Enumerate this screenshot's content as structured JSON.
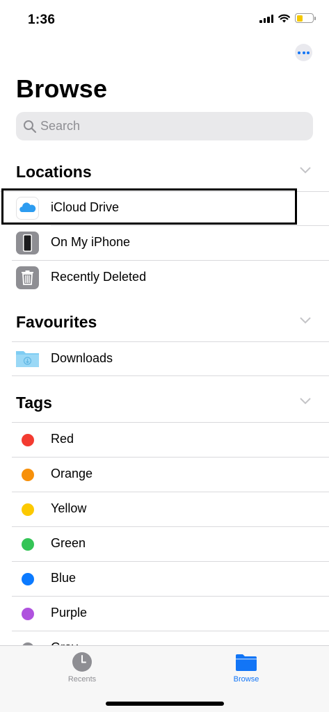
{
  "status_bar": {
    "time": "1:36",
    "battery_color": "#f4c800"
  },
  "header": {
    "title": "Browse",
    "more_icon": "ellipsis-circle-icon"
  },
  "search": {
    "placeholder": "Search",
    "icon": "search-icon"
  },
  "colors": {
    "accent": "#1275f6",
    "inactive_tab": "#8e8e93",
    "divider": "#d9d9dc"
  },
  "sections": {
    "locations": {
      "title": "Locations",
      "items": [
        {
          "label": "iCloud Drive",
          "icon": "icloud-icon",
          "highlighted": true
        },
        {
          "label": "On My iPhone",
          "icon": "iphone-icon"
        },
        {
          "label": "Recently Deleted",
          "icon": "trash-icon"
        }
      ]
    },
    "favourites": {
      "title": "Favourites",
      "items": [
        {
          "label": "Downloads",
          "icon": "downloads-folder-icon"
        }
      ]
    },
    "tags": {
      "title": "Tags",
      "items": [
        {
          "label": "Red",
          "color": "#f33b30"
        },
        {
          "label": "Orange",
          "color": "#f7900a"
        },
        {
          "label": "Yellow",
          "color": "#fcc900"
        },
        {
          "label": "Green",
          "color": "#34c456"
        },
        {
          "label": "Blue",
          "color": "#0b7aff"
        },
        {
          "label": "Purple",
          "color": "#af52de"
        },
        {
          "label": "Gray",
          "color": "#8e8e93"
        }
      ]
    }
  },
  "tab_bar": {
    "tabs": [
      {
        "label": "Recents",
        "icon": "clock-icon",
        "active": false
      },
      {
        "label": "Browse",
        "icon": "folder-icon",
        "active": true
      }
    ]
  }
}
